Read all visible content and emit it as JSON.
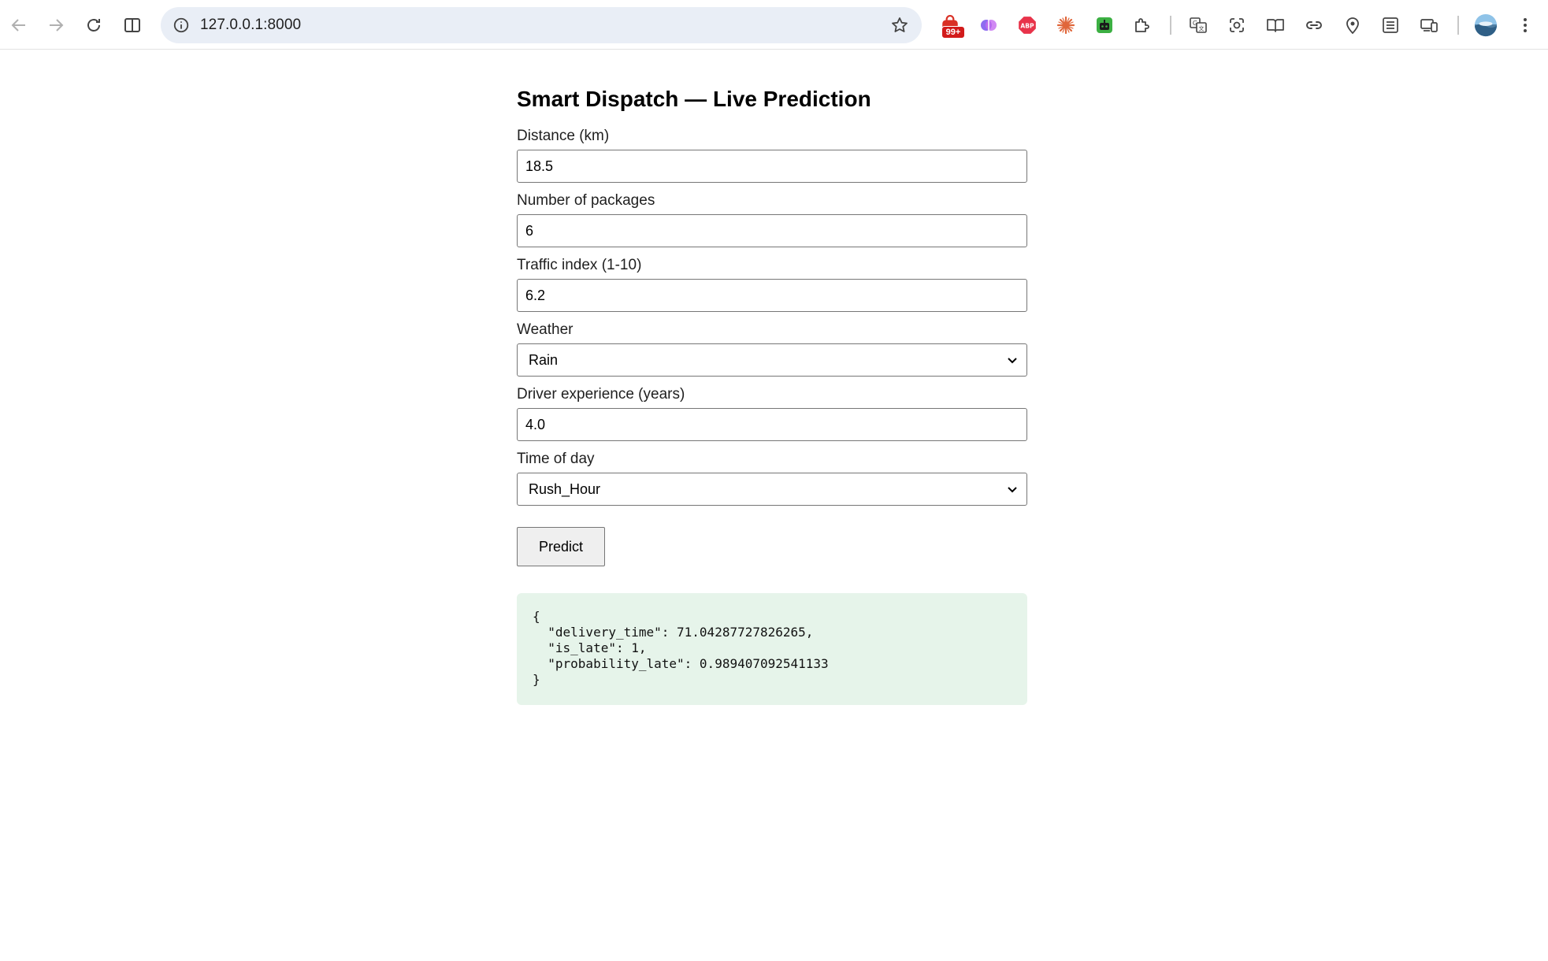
{
  "browser": {
    "url": "127.0.0.1:8000",
    "extension_badge": "99+"
  },
  "page": {
    "title": "Smart Dispatch — Live Prediction",
    "fields": [
      {
        "label": "Distance (km)",
        "value": "18.5"
      },
      {
        "label": "Number of packages",
        "value": "6"
      },
      {
        "label": "Traffic index (1-10)",
        "value": "6.2"
      },
      {
        "label": "Weather",
        "value": "Rain"
      },
      {
        "label": "Driver experience (years)",
        "value": "4.0"
      },
      {
        "label": "Time of day",
        "value": "Rush_Hour"
      }
    ],
    "predict_label": "Predict",
    "result_json": "{\n  \"delivery_time\": 71.04287727826265,\n  \"is_late\": 1,\n  \"probability_late\": 0.989407092541133\n}"
  },
  "colors": {
    "result_bg": "#e6f4ea",
    "omnibox_bg": "#e9eef6"
  }
}
